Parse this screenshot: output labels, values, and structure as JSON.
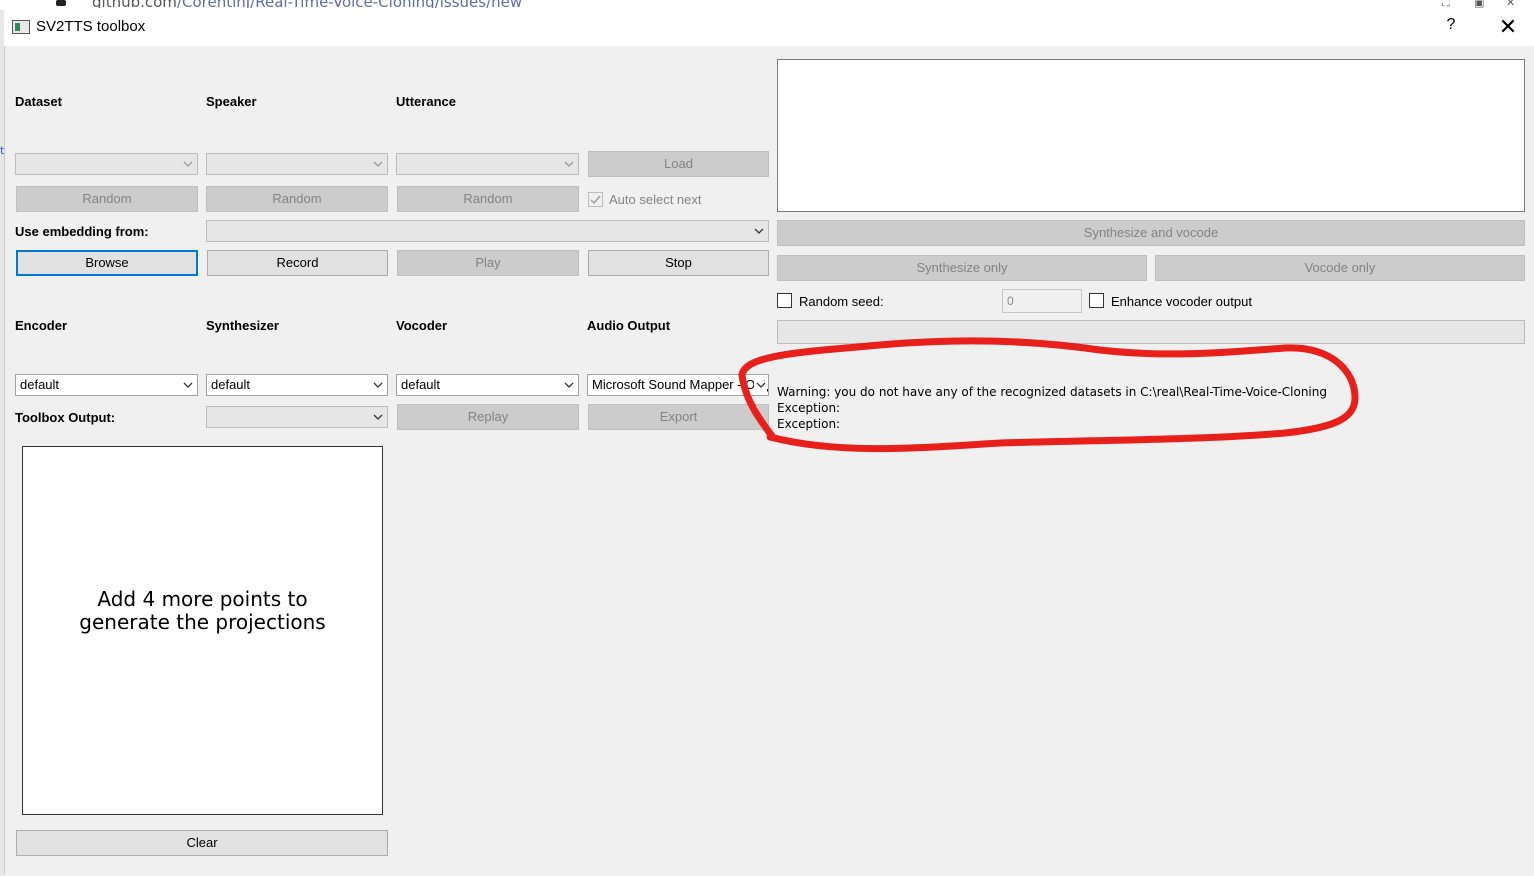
{
  "background": {
    "url_host": "github.com",
    "url_path": "/CorentinJ/Real-Time-Voice-Cloning/issues/new"
  },
  "window": {
    "title": "SV2TTS toolbox",
    "help_label": "?",
    "close_label": "✕"
  },
  "browse_section": {
    "labels": {
      "dataset": "Dataset",
      "speaker": "Speaker",
      "utterance": "Utterance"
    },
    "dataset_value": "",
    "speaker_value": "",
    "utterance_value": "",
    "load_label": "Load",
    "random_dataset_label": "Random",
    "random_speaker_label": "Random",
    "random_utterance_label": "Random",
    "auto_select_label": "Auto select next",
    "auto_select_checked": true,
    "use_embedding_label": "Use embedding from:",
    "embedding_value": "",
    "browse_label": "Browse",
    "record_label": "Record",
    "play_label": "Play",
    "stop_label": "Stop"
  },
  "models_section": {
    "labels": {
      "encoder": "Encoder",
      "synthesizer": "Synthesizer",
      "vocoder": "Vocoder",
      "audio_output": "Audio Output"
    },
    "encoder_value": "default",
    "synthesizer_value": "default",
    "vocoder_value": "default",
    "audio_output_value": "Microsoft Sound Mapper - Output",
    "toolbox_output_label": "Toolbox Output:",
    "toolbox_output_value": "",
    "replay_label": "Replay",
    "export_label": "Export"
  },
  "projections": {
    "message_line1": "Add 4 more points to",
    "message_line2": "generate the projections",
    "clear_label": "Clear"
  },
  "generation": {
    "text_value": "",
    "synthesize_vocode_label": "Synthesize and vocode",
    "synthesize_only_label": "Synthesize only",
    "vocode_only_label": "Vocode only",
    "random_seed_label": "Random seed:",
    "random_seed_checked": false,
    "seed_value": "0",
    "enhance_label": "Enhance vocoder output",
    "enhance_checked": false,
    "progress": 0
  },
  "log": {
    "lines": [
      "Warning: you do not have any of the recognized datasets in C:\\real\\Real-Time-Voice-Cloning",
      "Exception:",
      "Exception:"
    ]
  },
  "colors": {
    "accent_focus": "#0078d7",
    "annotation_red": "#e8201c",
    "window_bg": "#f0f0f0"
  }
}
